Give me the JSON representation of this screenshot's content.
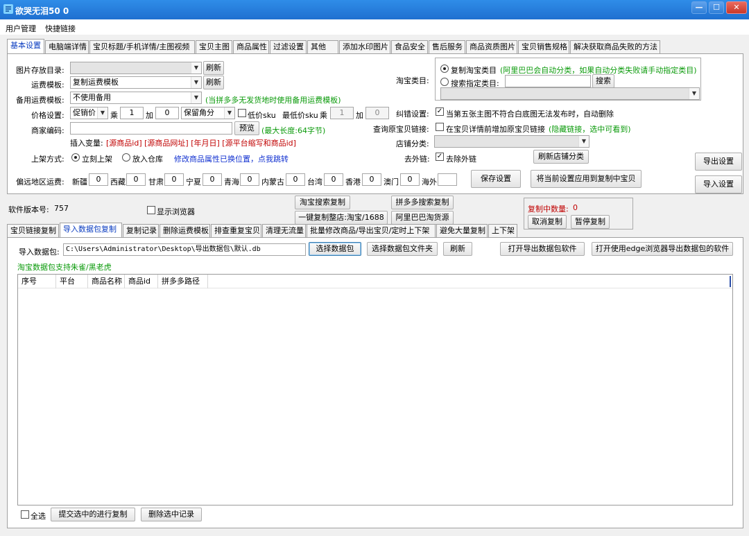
{
  "window": {
    "title": "欲哭无泪50 0",
    "min": "—",
    "max": "☐",
    "close": "✕"
  },
  "menu": [
    "用户管理",
    "快捷链接"
  ],
  "top_tabs": [
    "基本设置",
    "电脑端详情",
    "宝贝标题/手机详情/主图视频",
    "宝贝主图",
    "商品属性",
    "过滤设置",
    "其他",
    "添加水印图片",
    "食品安全",
    "售后服务",
    "商品资质图片",
    "宝贝销售规格",
    "解决获取商品失败的方法"
  ],
  "settings": {
    "image_dir_label": "图片存放目录:",
    "refresh": "刷新",
    "shipping_label": "运费模板:",
    "shipping_value": "复制运费模板",
    "backup_label": "备用运费模板:",
    "backup_value": "不使用备用",
    "backup_note": "(当拼多多无发货地时使用备用运费模板)",
    "price_label": "价格设置:",
    "price_mode": "促销价",
    "multiply": "乘",
    "price_factor": "1",
    "add": "加",
    "price_add": "0",
    "rounding": "保留角分",
    "low_sku": "低价sku",
    "lowest_sku": "最低价sku",
    "multiply2": "乘",
    "low_factor": "1",
    "add2": "加",
    "low_add": "0",
    "merchant_label": "商家编码:",
    "preview": "预览",
    "max_len": "(最大长度:64字节)",
    "insert_var": "插入变量:",
    "var_items": "[源商品id] [源商品网址] [年月日] [源平台缩写和商品id]",
    "listing_label": "上架方式:",
    "listing_now": "立刻上架",
    "listing_stock": "放入仓库",
    "attr_link": "修改商品属性已换位置，点我跳转",
    "remote_label": "偏远地区运费:",
    "regions": [
      {
        "name": "新疆",
        "value": "0"
      },
      {
        "name": "西藏",
        "value": "0"
      },
      {
        "name": "甘肃",
        "value": "0"
      },
      {
        "name": "宁夏",
        "value": "0"
      },
      {
        "name": "青海",
        "value": "0"
      },
      {
        "name": "内蒙古",
        "value": "0"
      },
      {
        "name": "台湾",
        "value": "0"
      },
      {
        "name": "香港",
        "value": "0"
      },
      {
        "name": "澳门",
        "value": "0"
      },
      {
        "name": "海外",
        "value": ""
      }
    ],
    "save": "保存设置",
    "apply": "将当前设置应用到复制中宝贝",
    "category_label": "淘宝类目:",
    "copy_category": "复制淘宝类目",
    "copy_category_note": "(阿里巴巴会自动分类，如果自动分类失败请手动指定类目)",
    "search_category": "搜索指定类目:",
    "search_btn": "搜索",
    "error_label": "纠错设置:",
    "error_text": "当第五张主图不符合白底图无法发布时，自动删除",
    "query_label": "查询原宝贝链接:",
    "query_text": "在宝贝详情前增加原宝贝链接",
    "query_note": "(隐藏链接，选中可看到)",
    "shop_cat_label": "店铺分类:",
    "outlink_label": "去外链:",
    "outlink_text": "去除外链",
    "refresh_shop_cat": "刷新店铺分类",
    "export_settings": "导出设置",
    "import_settings": "导入设置"
  },
  "mid": {
    "version_label": "软件版本号:",
    "version": "757",
    "show_browser": "显示浏览器",
    "taobao_search_copy": "淘宝搜索复制",
    "pdd_search_copy": "拼多多搜索复制",
    "one_key": "一键复制整店:淘宝/1688",
    "ali_source": "阿里巴巴淘货源",
    "copying_label": "复制中数量:",
    "copying_count": "0",
    "cancel_copy": "取消复制",
    "pause_copy": "暂停复制"
  },
  "bottom_tabs": [
    "宝贝链接复制",
    "导入数据包复制",
    "复制记录",
    "删除运费模板",
    "排查重复宝贝",
    "清理无流量",
    "批量修改商品/导出宝贝/定时上下架",
    "避免大量复制",
    "上下架"
  ],
  "import": {
    "label": "导入数据包:",
    "path": "C:\\Users\\Administrator\\Desktop\\导出数据包\\默认.db",
    "select_pkg": "选择数据包",
    "select_folder": "选择数据包文件夹",
    "refresh": "刷新",
    "open_export": "打开导出数据包软件",
    "open_edge": "打开使用edge浏览器导出数据包的软件",
    "support_note": "淘宝数据包支持朱雀/黑老虎",
    "columns": [
      "序号",
      "平台",
      "商品名称",
      "商品id",
      "拼多多路径"
    ]
  },
  "footer": {
    "select_all": "全选",
    "submit": "提交选中的进行复制",
    "delete": "删除选中记录"
  },
  "colors": {
    "title_bar": "#1f6fd0",
    "accent_green": "#0a9a0a",
    "accent_red": "#c00000",
    "link_blue": "#1030d0"
  }
}
